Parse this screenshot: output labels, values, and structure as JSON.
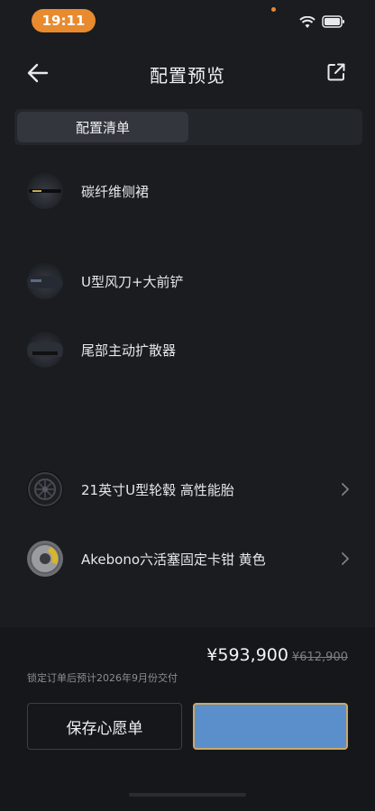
{
  "status_bar": {
    "time": "19:11",
    "icons": [
      "wifi-icon",
      "battery-icon"
    ]
  },
  "header": {
    "title": "配置预览",
    "back_icon": "arrow-left-icon",
    "share_icon": "share-icon"
  },
  "tabs": [
    {
      "label": "配置清单",
      "active": true
    },
    {
      "label": "",
      "active": false
    }
  ],
  "config_items": [
    {
      "label": "碳纤维侧裙",
      "icon": "side-skirt-thumb",
      "has_arrow": false
    },
    {
      "label": "U型风刀+大前铲",
      "icon": "front-splitter-thumb",
      "has_arrow": false
    },
    {
      "label": "尾部主动扩散器",
      "icon": "rear-diffuser-thumb",
      "has_arrow": false
    },
    {
      "label": "21英寸U型轮毂 高性能胎",
      "icon": "wheel-thumb",
      "has_arrow": true
    },
    {
      "label": "Akebono六活塞固定卡钳 黄色",
      "icon": "caliper-thumb",
      "has_arrow": true
    }
  ],
  "footer": {
    "price": "¥593,900",
    "original_price": "¥612,900",
    "delivery_note": "锁定订单后预计2026年9月份交付",
    "wishlist_button": "保存心愿单",
    "primary_button": ""
  },
  "colors": {
    "accent_orange": "#e88a2e",
    "primary_blue": "#5b8fcb",
    "gold_border": "#caa86a",
    "background": "#1a1c20"
  }
}
